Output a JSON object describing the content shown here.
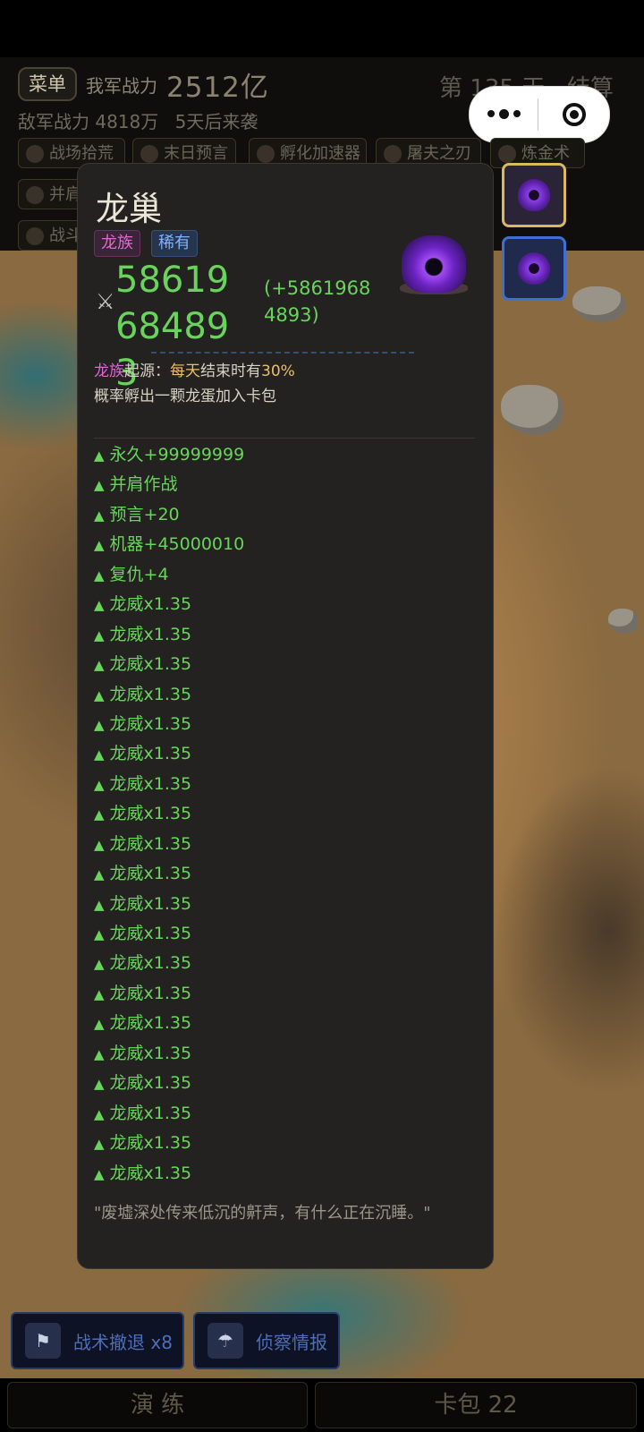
{
  "hud": {
    "menu_label": "菜单",
    "army_power_label": "我军战力",
    "army_power_value": "2512亿",
    "day_text": "第 135 天 · 结算",
    "enemy_power_label": "敌军战力 4818万",
    "enemy_attack_text": "5天后来袭"
  },
  "chips": {
    "c1": "战场拾荒",
    "c2": "末日预言",
    "c3": "孵化加速器",
    "c4": "屠夫之刃",
    "c5": "炼金术",
    "c6": "并肩",
    "c7": "战斗"
  },
  "panel": {
    "title": "龙巢",
    "tag_race": "龙族",
    "tag_rarity": "稀有",
    "power": "58619684893",
    "power_delta": "(+58619684893)",
    "origin_race": "龙族",
    "origin_label": "起源：",
    "origin_day": "每天",
    "origin_mid": "结束时有",
    "origin_pct": "30%",
    "origin_end": "概率孵出一颗龙蛋加入卡包",
    "bonuses": [
      "永久+99999999",
      "并肩作战",
      "预言+20",
      "机器+45000010",
      "复仇+4",
      "龙威x1.35",
      "龙威x1.35",
      "龙威x1.35",
      "龙威x1.35",
      "龙威x1.35",
      "龙威x1.35",
      "龙威x1.35",
      "龙威x1.35",
      "龙威x1.35",
      "龙威x1.35",
      "龙威x1.35",
      "龙威x1.35",
      "龙威x1.35",
      "龙威x1.35",
      "龙威x1.35",
      "龙威x1.35",
      "龙威x1.35",
      "龙威x1.35",
      "龙威x1.35",
      "龙威x1.35"
    ],
    "quote": "\"废墟深处传来低沉的鼾声，有什么正在沉睡。\""
  },
  "bottom": {
    "retreat_label": "战术撤退 x8",
    "scout_label": "侦察情报",
    "train_label": "演 练",
    "deck_label": "卡包 22"
  },
  "colors": {
    "bonus_green": "#69d45c",
    "dragon_pink": "#e06ad0",
    "rare_blue": "#7fb2ff",
    "gold": "#e8c06a"
  }
}
